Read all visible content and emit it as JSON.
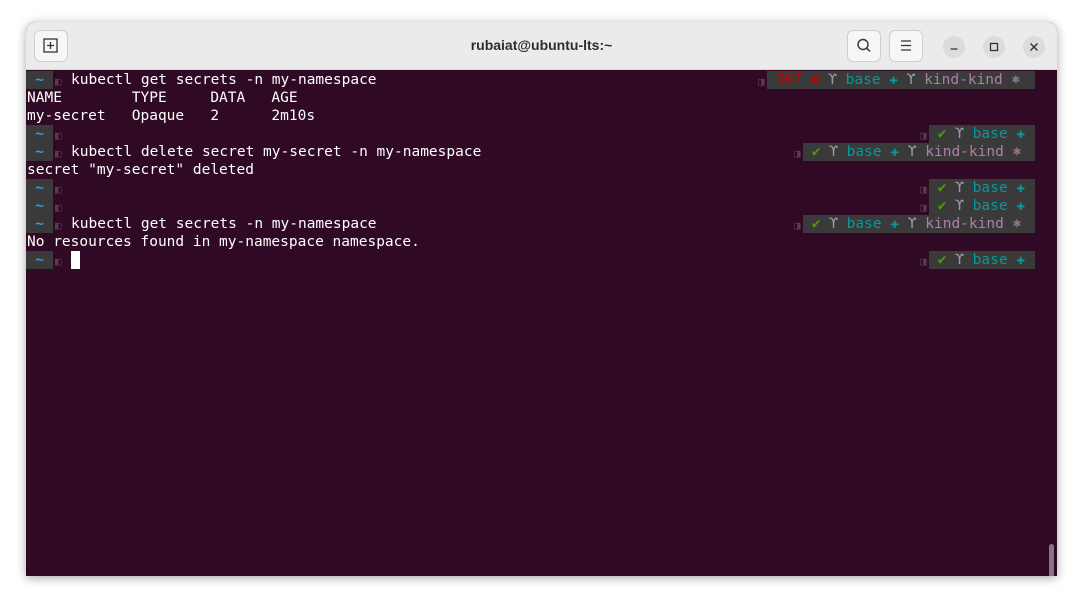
{
  "window": {
    "title": "rubaiat@ubuntu-lts:~"
  },
  "prompt": {
    "home": "~"
  },
  "lines": [
    {
      "cmd": "kubectl get secrets -n my-namespace",
      "right": {
        "int": "INT",
        "x": "✘",
        "y": "ϒ",
        "base": "base",
        "cross": "✚",
        "y2": "ϒ",
        "kind": "kind-kind",
        "gear": "⎈"
      }
    },
    {
      "out": "NAME        TYPE     DATA   AGE"
    },
    {
      "out": "my-secret   Opaque   2      2m10s"
    },
    {
      "cmd": "",
      "right": {
        "check": "✔",
        "y": "ϒ",
        "base": "base",
        "cross": "✚"
      }
    },
    {
      "cmd": "kubectl delete secret my-secret -n my-namespace",
      "right": {
        "check": "✔",
        "y": "ϒ",
        "base": "base",
        "cross": "✚",
        "y2": "ϒ",
        "kind": "kind-kind",
        "gear": "⎈"
      }
    },
    {
      "out": "secret \"my-secret\" deleted"
    },
    {
      "cmd": "",
      "right": {
        "check": "✔",
        "y": "ϒ",
        "base": "base",
        "cross": "✚"
      }
    },
    {
      "cmd": "",
      "right": {
        "check": "✔",
        "y": "ϒ",
        "base": "base",
        "cross": "✚"
      }
    },
    {
      "cmd": "kubectl get secrets -n my-namespace",
      "right": {
        "check": "✔",
        "y": "ϒ",
        "base": "base",
        "cross": "✚",
        "y2": "ϒ",
        "kind": "kind-kind",
        "gear": "⎈"
      }
    },
    {
      "out": "No resources found in my-namespace namespace."
    },
    {
      "cmd": "",
      "right": {
        "check": "✔",
        "y": "ϒ",
        "base": "base",
        "cross": "✚"
      }
    }
  ],
  "colors": {
    "terminal_bg": "#300a24",
    "ok": "#4e9a06",
    "error": "#cc0000",
    "cyan": "#06989a",
    "magenta": "#ad7fa8",
    "home": "#2aa1d9"
  }
}
